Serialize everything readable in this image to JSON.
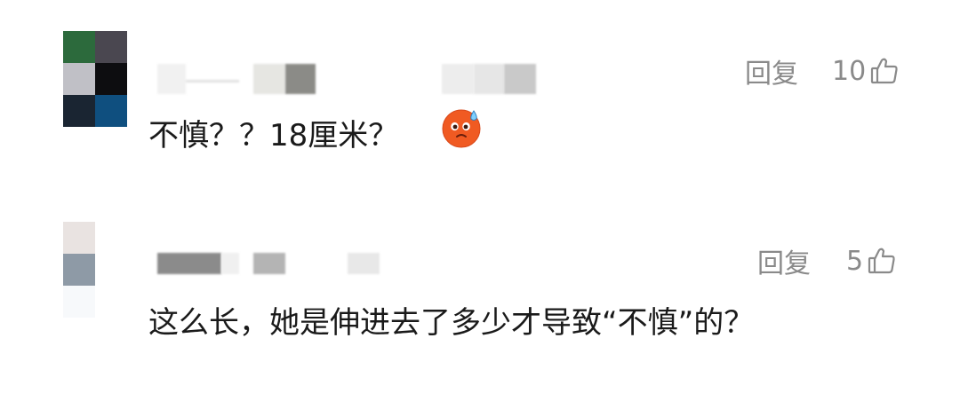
{
  "comments": [
    {
      "reply_label": "回复",
      "like_count": "10",
      "text": "不慎？？18厘米？",
      "emoji": "sweat-face-emoji",
      "avatar_colors": [
        "#2c6a3c",
        "#4a4750",
        "#c0c0c6",
        "#0d0d10",
        "#1a2532",
        "#0f4f7f"
      ]
    },
    {
      "reply_label": "回复",
      "like_count": "5",
      "text": "这么长，她是伸进去了多少才导致“不慎”的？",
      "avatar_colors": [
        "#e9e3e1",
        "#ffffff",
        "#8e9aa6",
        "#ffffff",
        "#ffffff",
        "#ffffff"
      ]
    }
  ],
  "icons": {
    "like": "thumbs-up-icon"
  },
  "colors": {
    "text": "#1a1a1a",
    "meta": "#8a8a8a",
    "background": "#ffffff"
  }
}
